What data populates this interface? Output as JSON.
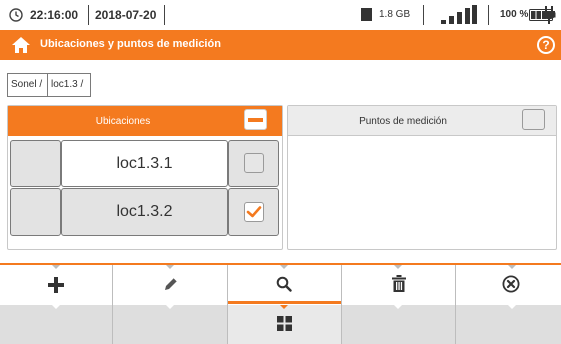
{
  "status": {
    "time": "22:16:00",
    "date": "2018-07-20",
    "memory": "1.8 GB",
    "battery": "100 %",
    "icons": [
      "clock-icon",
      "sd-card-icon",
      "signal-icon",
      "battery-icon",
      "plug-icon"
    ]
  },
  "header": {
    "title": "Ubicaciones y puntos de medición",
    "help": "?",
    "accent": "#f47a1f"
  },
  "breadcrumb": [
    "Sonel /",
    "loc1.3 /"
  ],
  "locations": {
    "header": "Ubicaciones",
    "select_all_state": "partial",
    "items": [
      {
        "name": "loc1.3.1",
        "checked": false
      },
      {
        "name": "loc1.3.2",
        "checked": true
      }
    ]
  },
  "points": {
    "header": "Puntos de medición",
    "select_all_state": "unchecked",
    "items": []
  },
  "toolbar": {
    "buttons": [
      "add-icon",
      "edit-icon",
      "search-icon",
      "delete-icon",
      "close-icon"
    ],
    "active": "search-icon",
    "secondary": [
      "grid-view-icon"
    ]
  }
}
